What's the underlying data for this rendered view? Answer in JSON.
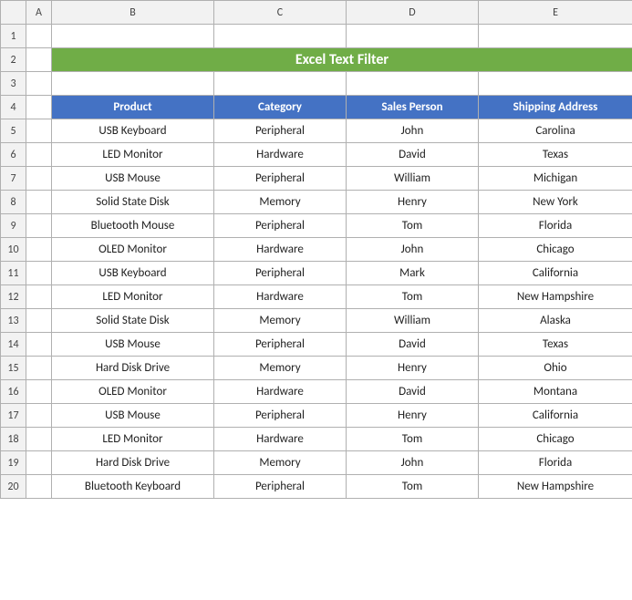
{
  "title": "Excel Text Filter",
  "columns": {
    "letters": [
      "A",
      "B",
      "C",
      "D",
      "E"
    ],
    "headers": [
      "Product",
      "Category",
      "Sales Person",
      "Shipping Address"
    ]
  },
  "rows": [
    {
      "num": 1,
      "cells": [
        "",
        "",
        "",
        "",
        ""
      ]
    },
    {
      "num": 2,
      "cells": [
        "title",
        "",
        "",
        "",
        ""
      ]
    },
    {
      "num": 3,
      "cells": [
        "",
        "",
        "",
        "",
        ""
      ]
    },
    {
      "num": 4,
      "cells": [
        "header",
        "header",
        "header",
        "header",
        "header"
      ]
    },
    {
      "num": 5,
      "cells": [
        "",
        "USB Keyboard",
        "Peripheral",
        "John",
        "Carolina"
      ]
    },
    {
      "num": 6,
      "cells": [
        "",
        "LED Monitor",
        "Hardware",
        "David",
        "Texas"
      ]
    },
    {
      "num": 7,
      "cells": [
        "",
        "USB Mouse",
        "Peripheral",
        "William",
        "Michigan"
      ]
    },
    {
      "num": 8,
      "cells": [
        "",
        "Solid State Disk",
        "Memory",
        "Henry",
        "New York"
      ]
    },
    {
      "num": 9,
      "cells": [
        "",
        "Bluetooth Mouse",
        "Peripheral",
        "Tom",
        "Florida"
      ]
    },
    {
      "num": 10,
      "cells": [
        "",
        "OLED Monitor",
        "Hardware",
        "John",
        "Chicago"
      ]
    },
    {
      "num": 11,
      "cells": [
        "",
        "USB Keyboard",
        "Peripheral",
        "Mark",
        "California"
      ]
    },
    {
      "num": 12,
      "cells": [
        "",
        "LED Monitor",
        "Hardware",
        "Tom",
        "New Hampshire"
      ]
    },
    {
      "num": 13,
      "cells": [
        "",
        "Solid State Disk",
        "Memory",
        "William",
        "Alaska"
      ]
    },
    {
      "num": 14,
      "cells": [
        "",
        "USB Mouse",
        "Peripheral",
        "David",
        "Texas"
      ]
    },
    {
      "num": 15,
      "cells": [
        "",
        "Hard Disk Drive",
        "Memory",
        "Henry",
        "Ohio"
      ]
    },
    {
      "num": 16,
      "cells": [
        "",
        "OLED Monitor",
        "Hardware",
        "David",
        "Montana"
      ]
    },
    {
      "num": 17,
      "cells": [
        "",
        "USB Mouse",
        "Peripheral",
        "Henry",
        "California"
      ]
    },
    {
      "num": 18,
      "cells": [
        "",
        "LED Monitor",
        "Hardware",
        "Tom",
        "Chicago"
      ]
    },
    {
      "num": 19,
      "cells": [
        "",
        "Hard Disk Drive",
        "Memory",
        "John",
        "Florida"
      ]
    },
    {
      "num": 20,
      "cells": [
        "",
        "Bluetooth Keyboard",
        "Peripheral",
        "Tom",
        "New Hampshire"
      ]
    }
  ]
}
